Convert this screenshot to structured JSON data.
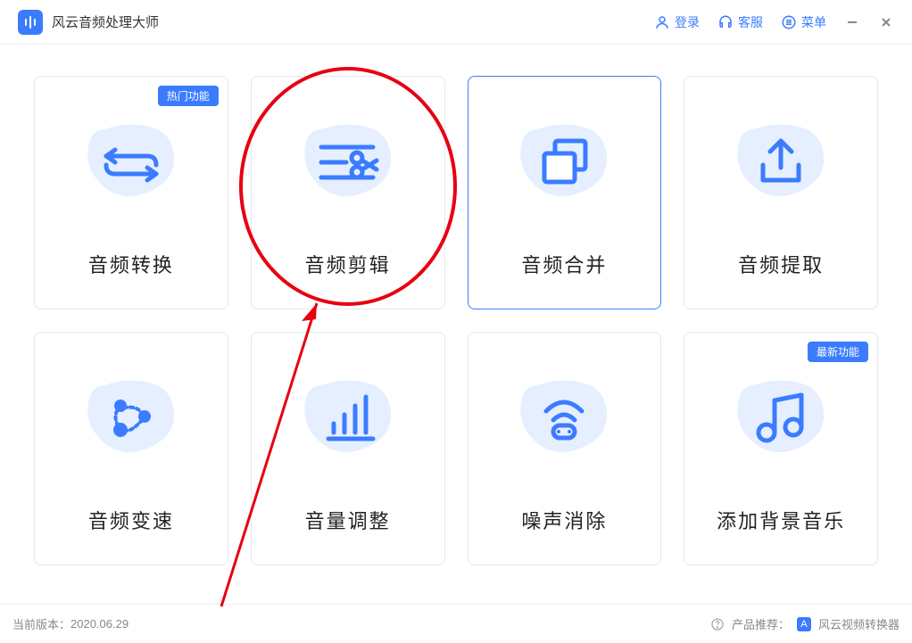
{
  "app": {
    "title": "风云音频处理大师"
  },
  "titlebar": {
    "login": "登录",
    "service": "客服",
    "menu": "菜单"
  },
  "cards": [
    {
      "label": "音频转换",
      "badge": "热门功能"
    },
    {
      "label": "音频剪辑",
      "badge": null
    },
    {
      "label": "音频合并",
      "badge": null
    },
    {
      "label": "音频提取",
      "badge": null
    },
    {
      "label": "音频变速",
      "badge": null
    },
    {
      "label": "音量调整",
      "badge": null
    },
    {
      "label": "噪声消除",
      "badge": null
    },
    {
      "label": "添加背景音乐",
      "badge": "最新功能"
    }
  ],
  "footer": {
    "version_label": "当前版本：",
    "version_value": "2020.06.29",
    "promo_label": "产品推荐：",
    "promo_product": "风云视频转换器"
  }
}
